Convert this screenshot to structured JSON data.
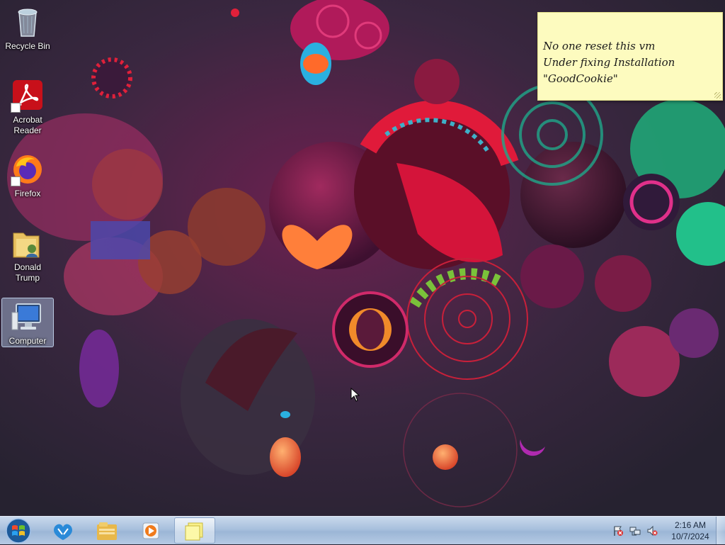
{
  "desktop": {
    "icons": [
      {
        "label": "Recycle Bin",
        "icon": "recycle-bin-icon"
      },
      {
        "label": "Acrobat Reader",
        "icon": "acrobat-reader-icon"
      },
      {
        "label": "Firefox",
        "icon": "firefox-icon"
      },
      {
        "label": "Donald Trump",
        "icon": "user-folder-icon"
      },
      {
        "label": "Computer",
        "icon": "computer-icon",
        "selected": true
      }
    ]
  },
  "sticky_note": {
    "lines": [
      "No one reset this vm",
      "Under fixing Installation",
      "\"GoodCookie\""
    ],
    "color": "#fdfbbf"
  },
  "taskbar": {
    "start_icon": "windows-start-orb-icon",
    "pinned": [
      {
        "name": "windows-live-icon"
      },
      {
        "name": "file-explorer-icon"
      },
      {
        "name": "media-player-icon"
      },
      {
        "name": "sticky-notes-icon",
        "active": true
      }
    ],
    "tray": [
      "action-center-flag-icon",
      "network-icon",
      "volume-muted-icon"
    ],
    "clock": {
      "time": "2:16 AM",
      "date": "10/7/2024"
    }
  },
  "colors": {
    "taskbar": "#a8c0dd",
    "accent": "#d61e5c"
  }
}
